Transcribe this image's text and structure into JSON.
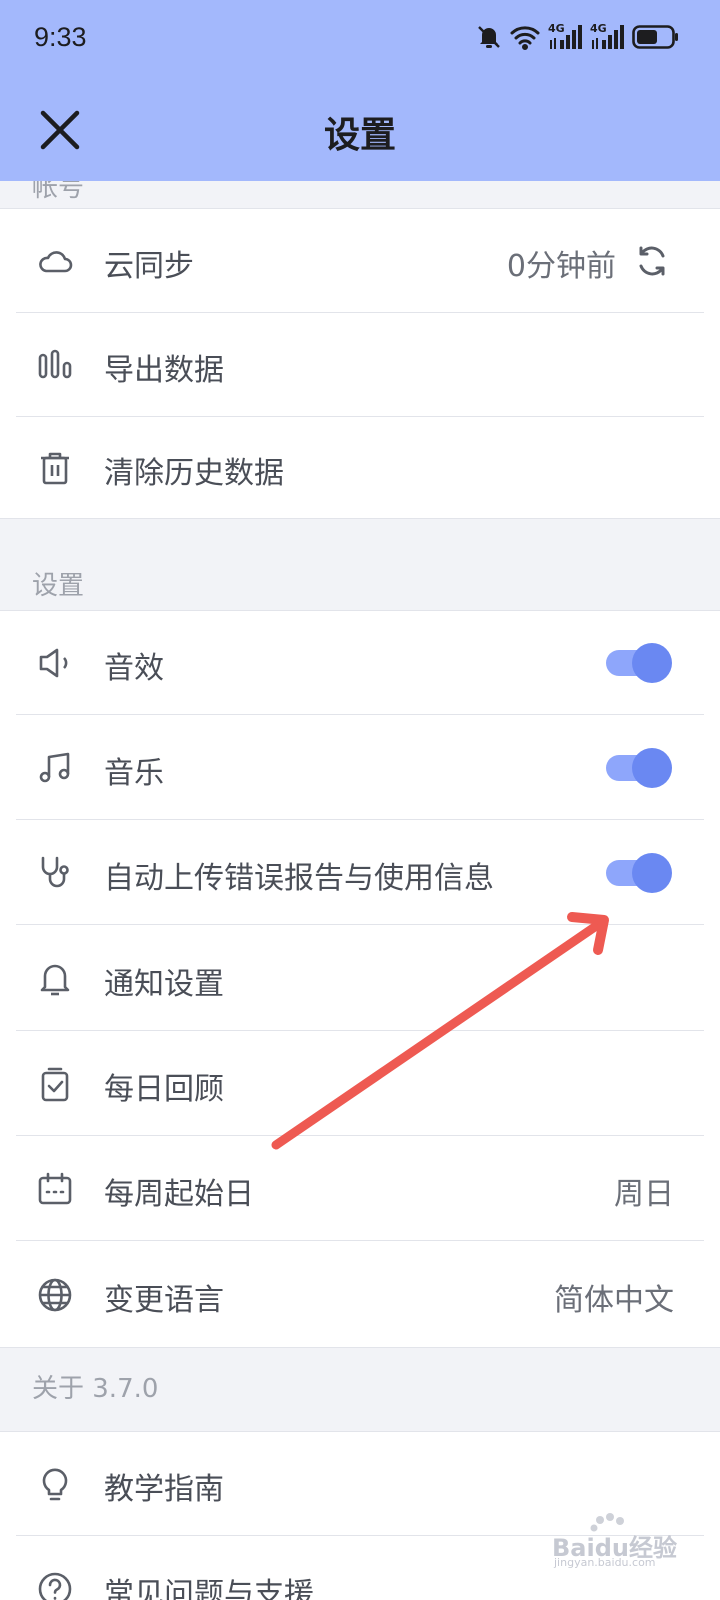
{
  "status_bar": {
    "time": "9:33",
    "net1": "4G",
    "net2": "4G",
    "battery_level": 0.6
  },
  "nav": {
    "title": "设置"
  },
  "sections": {
    "account": {
      "label": "帐号",
      "items": [
        {
          "label": "云同步",
          "value": "0分钟前",
          "icon": "cloud-icon"
        },
        {
          "label": "导出数据",
          "icon": "bar-chart-icon"
        },
        {
          "label": "清除历史数据",
          "icon": "trash-icon"
        }
      ]
    },
    "settings": {
      "label": "设置",
      "items": [
        {
          "label": "音效",
          "icon": "speaker-icon",
          "toggle": true
        },
        {
          "label": "音乐",
          "icon": "music-note-icon",
          "toggle": true
        },
        {
          "label": "自动上传错误报告与使用信息",
          "icon": "stethoscope-icon",
          "toggle": true
        },
        {
          "label": "通知设置",
          "icon": "bell-icon"
        },
        {
          "label": "每日回顾",
          "icon": "clipboard-check-icon"
        },
        {
          "label": "每周起始日",
          "value": "周日",
          "icon": "calendar-icon"
        },
        {
          "label": "变更语言",
          "value": "简体中文",
          "icon": "globe-icon"
        }
      ]
    },
    "about": {
      "label": "关于 3.7.0",
      "items": [
        {
          "label": "教学指南",
          "icon": "lightbulb-icon"
        },
        {
          "label": "常见问题与支援",
          "icon": "help-circle-icon"
        }
      ]
    }
  },
  "watermark": {
    "text": "Baidu经验",
    "subtext": "jingyan.baidu.com"
  },
  "colors": {
    "header": "#a3b8fc",
    "toggle_on": "#6a88f2",
    "arrow": "#ee5a52"
  }
}
